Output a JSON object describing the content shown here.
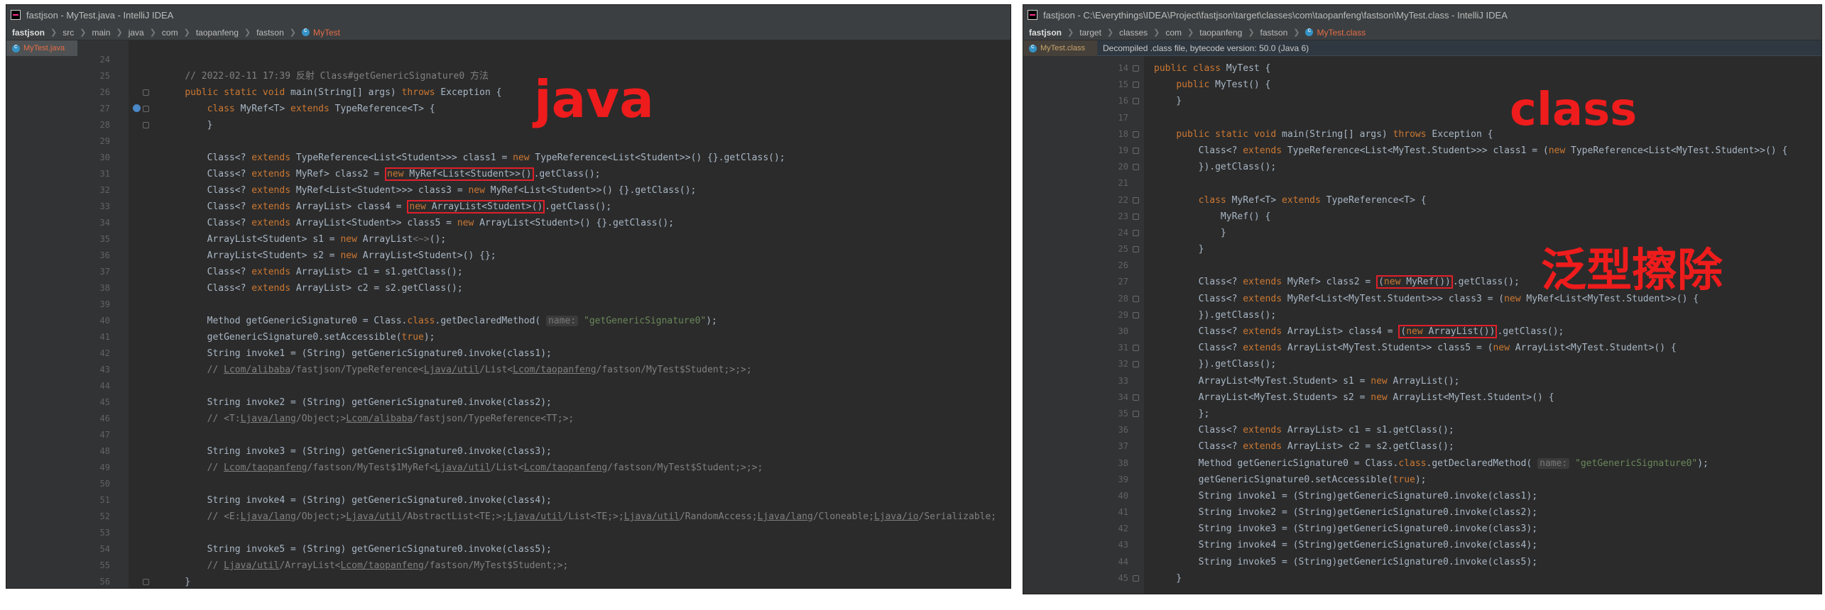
{
  "annotations": {
    "java": "java",
    "class": "class",
    "erasure": "泛型擦除"
  },
  "colors": {
    "keyword": "#cc7832",
    "string": "#6a8759",
    "comment": "#808080",
    "text": "#a9b7c6",
    "background": "#2b2b2b",
    "annotation": "#ee1c1c"
  },
  "left_window": {
    "title": "fastjson - MyTest.java - IntelliJ IDEA",
    "breadcrumb": [
      "fastjson",
      "src",
      "main",
      "java",
      "com",
      "taopanfeng",
      "fastson",
      "MyTest"
    ],
    "file_tab": "MyTest.java",
    "lines": [
      {
        "n": "24",
        "t": ""
      },
      {
        "n": "25",
        "t": "    // 2022-02-11 17:39 反射 Class#getGenericSignature0 方法"
      },
      {
        "n": "26",
        "t": "    public static void main(String[] args) throws Exception {"
      },
      {
        "n": "27",
        "t": "        class MyRef<T> extends TypeReference<T> {"
      },
      {
        "n": "28",
        "t": "        }"
      },
      {
        "n": "29",
        "t": ""
      },
      {
        "n": "30",
        "t": "        Class<? extends TypeReference<List<Student>>> class1 = new TypeReference<List<Student>>() {}.getClass();"
      },
      {
        "n": "31",
        "t": "        Class<? extends MyRef> class2 = new MyRef<List<Student>>().getClass();"
      },
      {
        "n": "32",
        "t": "        Class<? extends MyRef<List<Student>>> class3 = new MyRef<List<Student>>() {}.getClass();"
      },
      {
        "n": "33",
        "t": "        Class<? extends ArrayList> class4 = new ArrayList<Student>().getClass();"
      },
      {
        "n": "34",
        "t": "        Class<? extends ArrayList<Student>> class5 = new ArrayList<Student>() {}.getClass();"
      },
      {
        "n": "35",
        "t": "        ArrayList<Student> s1 = new ArrayList<~>();"
      },
      {
        "n": "36",
        "t": "        ArrayList<Student> s2 = new ArrayList<Student>() {};"
      },
      {
        "n": "37",
        "t": "        Class<? extends ArrayList> c1 = s1.getClass();"
      },
      {
        "n": "38",
        "t": "        Class<? extends ArrayList> c2 = s2.getClass();"
      },
      {
        "n": "39",
        "t": ""
      },
      {
        "n": "40",
        "t": "        Method getGenericSignature0 = Class.class.getDeclaredMethod( name: \"getGenericSignature0\");"
      },
      {
        "n": "41",
        "t": "        getGenericSignature0.setAccessible(true);"
      },
      {
        "n": "42",
        "t": "        String invoke1 = (String) getGenericSignature0.invoke(class1);"
      },
      {
        "n": "43",
        "t": "        // Lcom/alibaba/fastjson/TypeReference<Ljava/util/List<Lcom/taopanfeng/fastson/MyTest$Student;>;>;"
      },
      {
        "n": "44",
        "t": ""
      },
      {
        "n": "45",
        "t": "        String invoke2 = (String) getGenericSignature0.invoke(class2);"
      },
      {
        "n": "46",
        "t": "        // <T:Ljava/lang/Object;>Lcom/alibaba/fastjson/TypeReference<TT;>;"
      },
      {
        "n": "47",
        "t": ""
      },
      {
        "n": "48",
        "t": "        String invoke3 = (String) getGenericSignature0.invoke(class3);"
      },
      {
        "n": "49",
        "t": "        // Lcom/taopanfeng/fastson/MyTest$1MyRef<Ljava/util/List<Lcom/taopanfeng/fastson/MyTest$Student;>;>;"
      },
      {
        "n": "50",
        "t": ""
      },
      {
        "n": "51",
        "t": "        String invoke4 = (String) getGenericSignature0.invoke(class4);"
      },
      {
        "n": "52",
        "t": "        // <E:Ljava/lang/Object;>Ljava/util/AbstractList<TE;>;Ljava/util/List<TE;>;Ljava/util/RandomAccess;Ljava/lang/Cloneable;Ljava/io/Serializable;"
      },
      {
        "n": "53",
        "t": ""
      },
      {
        "n": "54",
        "t": "        String invoke5 = (String) getGenericSignature0.invoke(class5);"
      },
      {
        "n": "55",
        "t": "        // Ljava/util/ArrayList<Lcom/taopanfeng/fastson/MyTest$Student;>;"
      },
      {
        "n": "56",
        "t": "    }"
      }
    ]
  },
  "right_window": {
    "title": "fastjson - C:\\Everythings\\IDEA\\Project\\fastjson\\target\\classes\\com\\taopanfeng\\fastson\\MyTest.class - IntelliJ IDEA",
    "breadcrumb": [
      "fastjson",
      "target",
      "classes",
      "com",
      "taopanfeng",
      "fastson",
      "MyTest.class"
    ],
    "file_tab": "MyTest.class",
    "banner": "Decompiled .class file, bytecode version: 50.0 (Java 6)",
    "lines": [
      {
        "n": "14",
        "t": "public class MyTest {"
      },
      {
        "n": "15",
        "t": "    public MyTest() {"
      },
      {
        "n": "16",
        "t": "    }"
      },
      {
        "n": "17",
        "t": ""
      },
      {
        "n": "18",
        "t": "    public static void main(String[] args) throws Exception {"
      },
      {
        "n": "19",
        "t": "        Class<? extends TypeReference<List<MyTest.Student>>> class1 = (new TypeReference<List<MyTest.Student>>() {"
      },
      {
        "n": "20",
        "t": "        }).getClass();"
      },
      {
        "n": "21",
        "t": ""
      },
      {
        "n": "22",
        "t": "        class MyRef<T> extends TypeReference<T> {"
      },
      {
        "n": "23",
        "t": "            MyRef() {"
      },
      {
        "n": "24",
        "t": "            }"
      },
      {
        "n": "25",
        "t": "        }"
      },
      {
        "n": "26",
        "t": ""
      },
      {
        "n": "27",
        "t": "        Class<? extends MyRef> class2 = (new MyRef()).getClass();"
      },
      {
        "n": "28",
        "t": "        Class<? extends MyRef<List<MyTest.Student>>> class3 = (new MyRef<List<MyTest.Student>>() {"
      },
      {
        "n": "29",
        "t": "        }).getClass();"
      },
      {
        "n": "30",
        "t": "        Class<? extends ArrayList> class4 = (new ArrayList()).getClass();"
      },
      {
        "n": "31",
        "t": "        Class<? extends ArrayList<MyTest.Student>> class5 = (new ArrayList<MyTest.Student>() {"
      },
      {
        "n": "32",
        "t": "        }).getClass();"
      },
      {
        "n": "33",
        "t": "        ArrayList<MyTest.Student> s1 = new ArrayList();"
      },
      {
        "n": "34",
        "t": "        ArrayList<MyTest.Student> s2 = new ArrayList<MyTest.Student>() {"
      },
      {
        "n": "35",
        "t": "        };"
      },
      {
        "n": "36",
        "t": "        Class<? extends ArrayList> c1 = s1.getClass();"
      },
      {
        "n": "37",
        "t": "        Class<? extends ArrayList> c2 = s2.getClass();"
      },
      {
        "n": "38",
        "t": "        Method getGenericSignature0 = Class.class.getDeclaredMethod( name: \"getGenericSignature0\");"
      },
      {
        "n": "39",
        "t": "        getGenericSignature0.setAccessible(true);"
      },
      {
        "n": "40",
        "t": "        String invoke1 = (String)getGenericSignature0.invoke(class1);"
      },
      {
        "n": "41",
        "t": "        String invoke2 = (String)getGenericSignature0.invoke(class2);"
      },
      {
        "n": "42",
        "t": "        String invoke3 = (String)getGenericSignature0.invoke(class3);"
      },
      {
        "n": "43",
        "t": "        String invoke4 = (String)getGenericSignature0.invoke(class4);"
      },
      {
        "n": "44",
        "t": "        String invoke5 = (String)getGenericSignature0.invoke(class5);"
      },
      {
        "n": "45",
        "t": "    }"
      }
    ]
  }
}
